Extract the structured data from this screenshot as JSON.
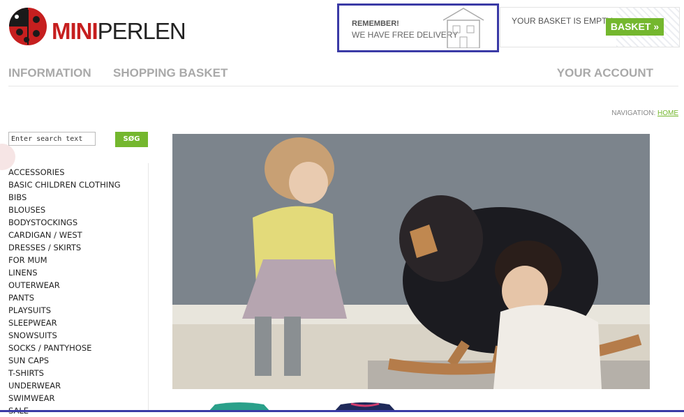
{
  "brand": {
    "part1": "MINI",
    "part2": "PERLEN"
  },
  "promo": {
    "title": "REMEMBER!",
    "subtitle": "WE HAVE FREE DELIVERY"
  },
  "basket": {
    "status": "YOUR BASKET IS EMPTY",
    "button_label": "BASKET »"
  },
  "nav": {
    "information": "INFORMATION",
    "shopping_basket": "SHOPPING BASKET",
    "your_account": "YOUR ACCOUNT"
  },
  "breadcrumb": {
    "prefix": "NAVIGATION:",
    "home": "HOME"
  },
  "search": {
    "placeholder": "Enter search text",
    "button_label": "SØG"
  },
  "categories": [
    "ACCESSORIES",
    "BASIC CHILDREN CLOTHING",
    "BIBS",
    "BLOUSES",
    "BODYSTOCKINGS",
    "CARDIGAN / WEST",
    "DRESSES / SKIRTS",
    "FOR MUM",
    "LINENS",
    "OUTERWEAR",
    "PANTS",
    "PLAYSUITS",
    "SLEEPWEAR",
    "SNOWSUITS",
    "SOCKS / PANTYHOSE",
    "SUN CAPS",
    "T-SHIRTS",
    "UNDERWEAR",
    "SWIMWEAR",
    "SALE"
  ],
  "colors": {
    "accent_green": "#74b72e",
    "brand_red": "#c61f1f",
    "highlight_border": "#3a3aa6",
    "nav_gray": "#a9a9a9"
  }
}
